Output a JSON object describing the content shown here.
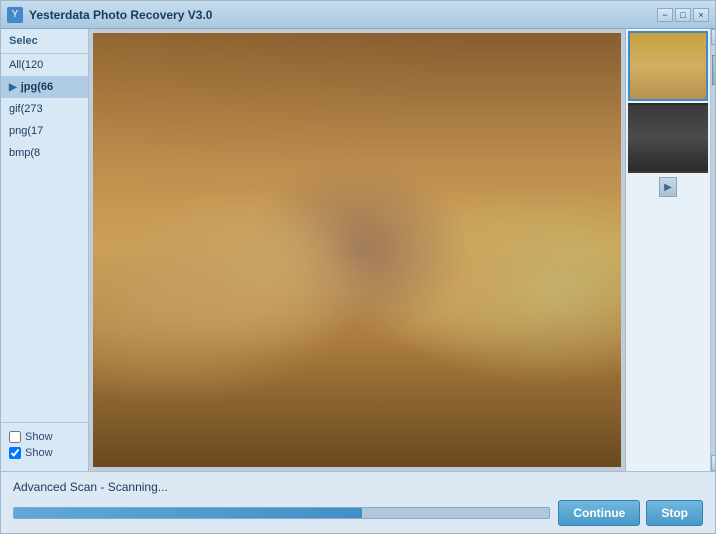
{
  "window": {
    "title": "Yesterdata Photo Recovery V3.0",
    "icon_label": "Y"
  },
  "title_buttons": {
    "minimize": "−",
    "maximize": "□",
    "close": "×"
  },
  "sidebar": {
    "header": "Selec",
    "items": [
      {
        "id": "all",
        "label": "All(120",
        "active": false
      },
      {
        "id": "jpg",
        "label": "jpg(66",
        "active": true
      },
      {
        "id": "gif",
        "label": "gif(273",
        "active": false
      },
      {
        "id": "png",
        "label": "png(17",
        "active": false
      },
      {
        "id": "bmp",
        "label": "bmp(8",
        "active": false
      }
    ],
    "checkboxes": [
      {
        "id": "show1",
        "label": "Show",
        "checked": false
      },
      {
        "id": "show2",
        "label": "Show",
        "checked": true
      }
    ]
  },
  "status": {
    "text": "Advanced Scan - Scanning...",
    "progress_percent": 65
  },
  "buttons": {
    "continue": "Continue",
    "stop": "Stop"
  },
  "scrollbar": {
    "up": "▲",
    "down": "▼",
    "forward": "▶"
  }
}
